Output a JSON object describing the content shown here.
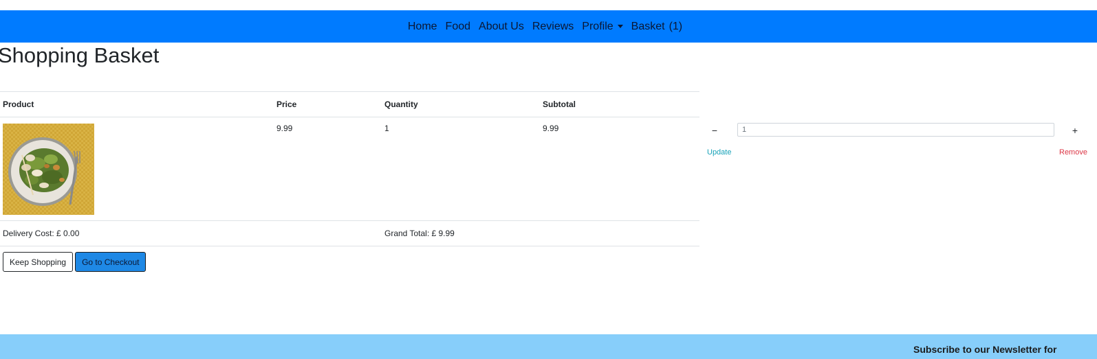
{
  "navbar": {
    "items": [
      {
        "label": "Home"
      },
      {
        "label": "Food"
      },
      {
        "label": "About Us"
      },
      {
        "label": "Reviews"
      },
      {
        "label": "Profile"
      },
      {
        "label": "Basket"
      }
    ],
    "basket_count": "(1)",
    "background_color": "#007bff"
  },
  "page": {
    "title": "Shopping Basket"
  },
  "table": {
    "headers": {
      "product": "Product",
      "price": "Price",
      "quantity": "Quantity",
      "subtotal": "Subtotal"
    },
    "rows": [
      {
        "product_image_icon": "salad-plate-image",
        "price": "9.99",
        "quantity": "1",
        "subtotal": "9.99",
        "qty_input_value": "1",
        "minus_label": "−",
        "plus_label": "+",
        "update_label": "Update",
        "remove_label": "Remove"
      }
    ],
    "delivery_cost": "Delivery Cost: £ 0.00",
    "grand_total": "Grand Total: £ 9.99"
  },
  "buttons": {
    "keep_shopping": "Keep Shopping",
    "checkout": "Go to Checkout"
  },
  "footer": {
    "newsletter_title": "Subscribe to our Newsletter for",
    "background_color": "#87cefa"
  }
}
